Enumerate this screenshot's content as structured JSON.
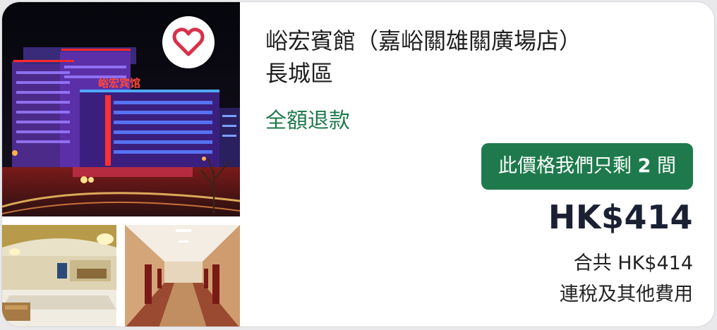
{
  "hotel": {
    "name": "峪宏賓館（嘉峪關雄關廣場店）",
    "district": "長城區",
    "refund_policy": "全額退款",
    "sign_text": "峪宏宾馆"
  },
  "badge": {
    "prefix": "此價格我們只剩",
    "count": "2",
    "suffix": "間"
  },
  "price": {
    "nightly": "HK$414",
    "total": "合共 HK$414",
    "tax_note": "連稅及其他費用"
  },
  "favorite": {
    "icon": "heart-icon"
  },
  "colors": {
    "refund_green": "#1f7a4d",
    "badge_green": "#1e7a4c",
    "heart": "#d9304a",
    "price_navy": "#1b2133"
  }
}
